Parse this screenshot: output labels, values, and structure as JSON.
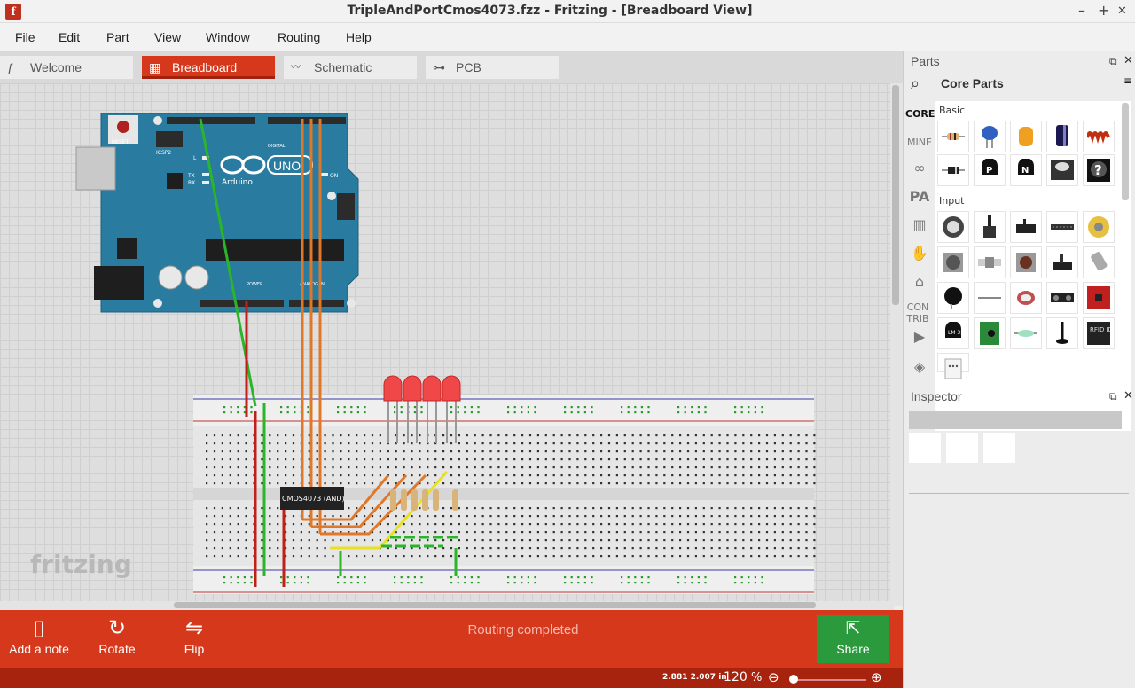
{
  "window": {
    "title": "TripleAndPortCmos4073.fzz - Fritzing - [Breadboard View]",
    "app_icon_glyph": "f",
    "minimize": "–",
    "maximize": "+",
    "close": "✕"
  },
  "menu": [
    "File",
    "Edit",
    "Part",
    "View",
    "Window",
    "Routing",
    "Help"
  ],
  "tabs": [
    {
      "label": "Welcome",
      "icon": "fritzing-f-icon",
      "glyph": "ƒ",
      "active": false
    },
    {
      "label": "Breadboard",
      "icon": "breadboard-icon",
      "glyph": "▦",
      "active": true
    },
    {
      "label": "Schematic",
      "icon": "schematic-icon",
      "glyph": "〰",
      "active": false
    },
    {
      "label": "PCB",
      "icon": "pcb-icon",
      "glyph": "⊶",
      "active": false
    }
  ],
  "canvas": {
    "watermark": "fritzing",
    "arduino_brand": "Arduino",
    "arduino_model": "UNO",
    "chip_label": "CMOS4073 (AND)",
    "arduino_labels": {
      "reset": "RESET",
      "icsp2": "ICSP2",
      "tx": "TX",
      "rx": "RX",
      "on": "ON",
      "digital": "DIGITAL",
      "power": "POWER",
      "analog": "ANALOG IN",
      "l": "L"
    }
  },
  "bottom_toolbar": {
    "add_note": "Add a note",
    "rotate": "Rotate",
    "flip": "Flip",
    "status": "Routing completed",
    "share": "Share"
  },
  "statusbar": {
    "coords": "2.881 2.007 in",
    "zoom": "120",
    "zoom_unit": "%"
  },
  "parts_panel": {
    "title": "Parts",
    "bin_title": "Core Parts",
    "bins": [
      "CORE",
      "MINE",
      "CON TRIB"
    ],
    "categories": [
      "Basic",
      "Input"
    ],
    "basic_parts": [
      "resistor-icon",
      "ceramic-capacitor-icon",
      "tantalum-capacitor-icon",
      "electrolytic-capacitor-icon",
      "inductor-icon",
      "diode-icon",
      "pnp-transistor-icon",
      "npn-transistor-icon",
      "power-label-icon",
      "mystery-part-icon"
    ],
    "input_parts": [
      "potentiometer-icon",
      "slide-potentiometer-icon",
      "trimmer-icon",
      "flex-sensor-icon",
      "rotary-encoder-icon",
      "rotary-potentiometer-icon",
      "button-icon",
      "pushbutton-icon",
      "toggle-switch-icon",
      "tilt-switch-icon",
      "photocell-icon",
      "wire-sensor-icon",
      "force-sensor-icon",
      "distance-sensor-icon",
      "accelerometer-icon",
      "temperature-sensor-icon",
      "module-icon",
      "reed-switch-icon",
      "antenna-icon",
      "rfid-reader-icon",
      "humidity-sensor-icon"
    ],
    "mystery_glyph": "?",
    "pnp_glyph": "P",
    "npn_glyph": "N",
    "rfid_label": "RFID ID12",
    "lm_label": "LM 35"
  },
  "inspector": {
    "title": "Inspector"
  },
  "colors": {
    "accent": "#d6381c",
    "share": "#2a9a3c",
    "arduino": "#2a7ba0",
    "wire_green": "#2ab52a",
    "wire_orange": "#e0782a",
    "wire_red": "#c0201a",
    "wire_yellow": "#e8e020",
    "led_red": "#f04848"
  }
}
